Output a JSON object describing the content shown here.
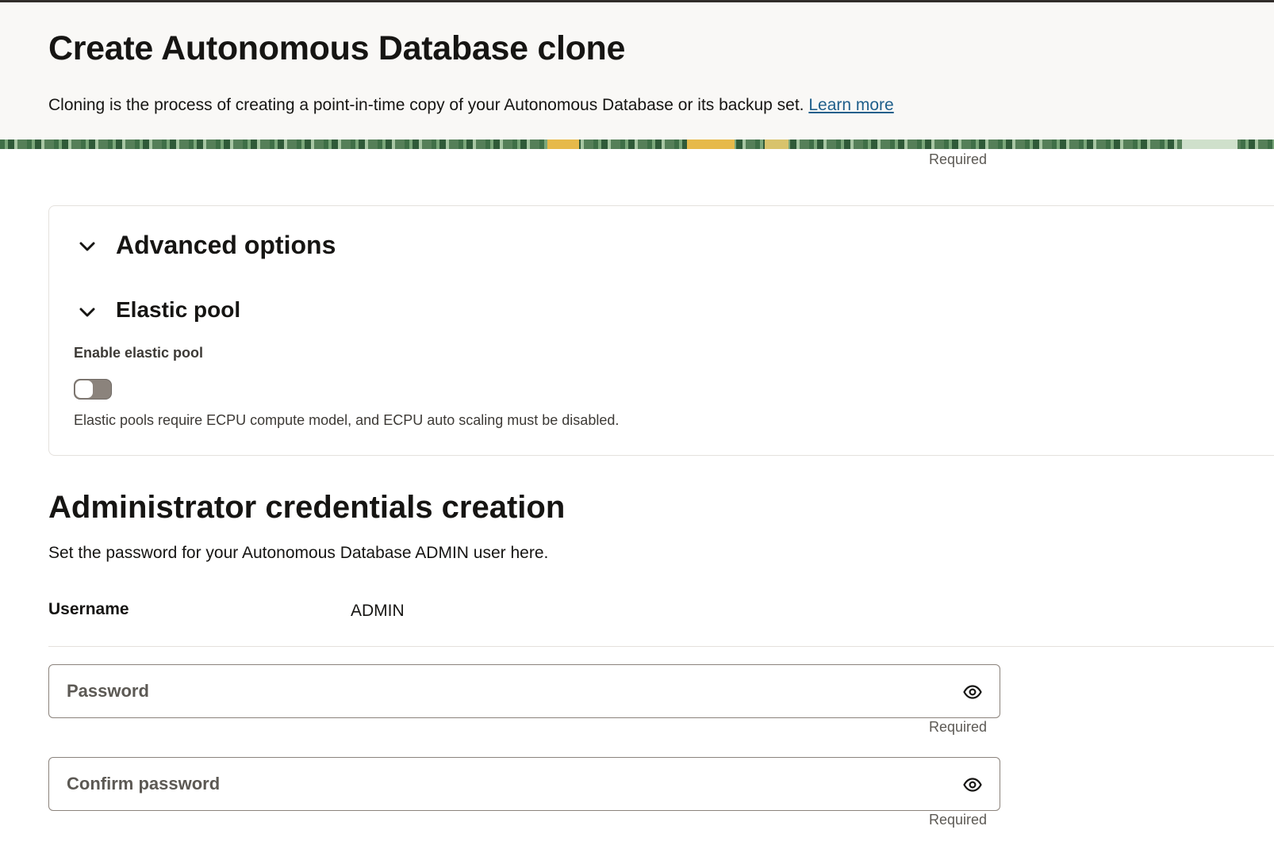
{
  "header": {
    "title": "Create Autonomous Database clone",
    "description": "Cloning is the process of creating a point-in-time copy of your Autonomous Database or its backup set. ",
    "learn_more": "Learn more"
  },
  "top_required": "Required",
  "advanced": {
    "title": "Advanced options",
    "elastic_pool": {
      "title": "Elastic pool",
      "enable_label": "Enable elastic pool",
      "toggle_on": false,
      "help_text": "Elastic pools require ECPU compute model, and ECPU auto scaling must be disabled."
    }
  },
  "admin": {
    "title": "Administrator credentials creation",
    "description": "Set the password for your Autonomous Database ADMIN user here.",
    "username_label": "Username",
    "username_value": "ADMIN",
    "password": {
      "placeholder": "Password",
      "value": "",
      "required": "Required"
    },
    "confirm_password": {
      "placeholder": "Confirm password",
      "value": "",
      "required": "Required"
    }
  },
  "icons": {
    "chevron": "chevron-down-icon",
    "eye": "eye-icon"
  },
  "colors": {
    "link": "#1f5f8b",
    "header_bg": "#f9f8f6",
    "toggle_off": "#8b837c"
  }
}
